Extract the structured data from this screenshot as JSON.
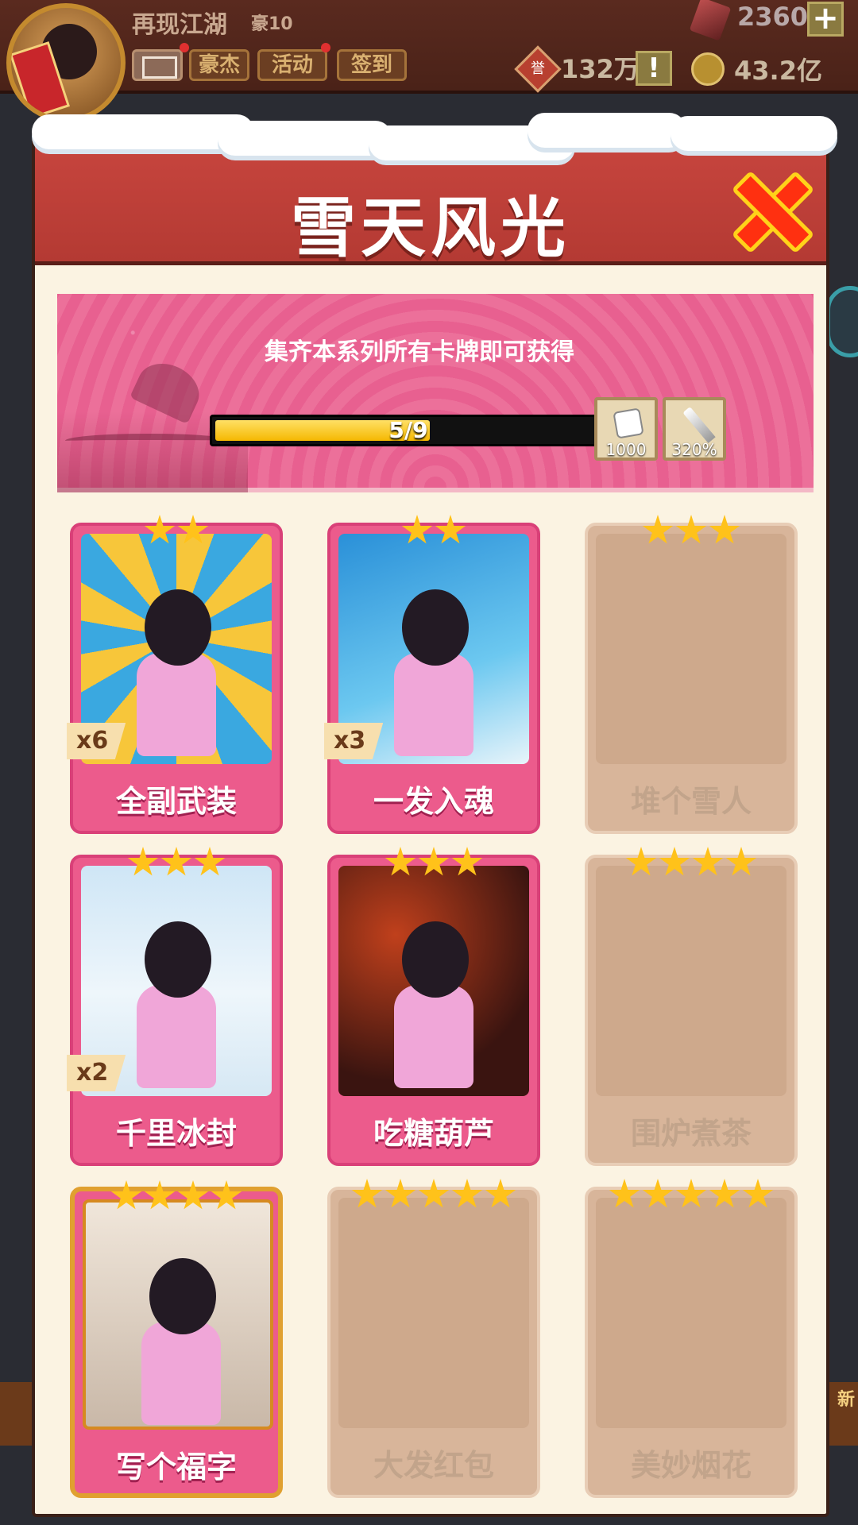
{
  "hud": {
    "title": "再现江湖",
    "rank": "豪10",
    "buttons": [
      "豪杰",
      "活动",
      "签到"
    ],
    "gems": "2360",
    "plus": "+",
    "honor_icon": "誉",
    "honor": "132万",
    "warn": "!",
    "coins": "43.2亿",
    "bg_new": "新"
  },
  "modal": {
    "title": "雪天风光",
    "close_icon": "close-x-icon"
  },
  "banner": {
    "text": "集齐本系列所有卡牌即可获得",
    "progress_label": "5/9",
    "progress_value": 5,
    "progress_max": 9,
    "rewards": [
      {
        "icon": "dice-icon",
        "label": "1000"
      },
      {
        "icon": "sword-icon",
        "label": "320%"
      }
    ]
  },
  "cards": [
    {
      "name": "全副武装",
      "stars": 2,
      "owned": true,
      "count": "x6",
      "art": "art-1"
    },
    {
      "name": "一发入魂",
      "stars": 2,
      "owned": true,
      "count": "x3",
      "art": "art-2"
    },
    {
      "name": "堆个雪人",
      "stars": 3,
      "owned": false,
      "count": "",
      "art": ""
    },
    {
      "name": "千里冰封",
      "stars": 3,
      "owned": true,
      "count": "x2",
      "art": "art-4"
    },
    {
      "name": "吃糖葫芦",
      "stars": 3,
      "owned": true,
      "count": "",
      "art": "art-5"
    },
    {
      "name": "围炉煮茶",
      "stars": 4,
      "owned": false,
      "count": "",
      "art": ""
    },
    {
      "name": "写个福字",
      "stars": 4,
      "owned": true,
      "count": "",
      "art": "art-7",
      "golden": true
    },
    {
      "name": "大发红包",
      "stars": 5,
      "owned": false,
      "count": "",
      "art": ""
    },
    {
      "name": "美妙烟花",
      "stars": 5,
      "owned": false,
      "count": "",
      "art": ""
    }
  ],
  "colors": {
    "header": "#c9463f",
    "card_owned": "#ec5b8c",
    "card_locked": "#d8b59a",
    "star": "#ffc21a",
    "progress": "#f5b800"
  }
}
